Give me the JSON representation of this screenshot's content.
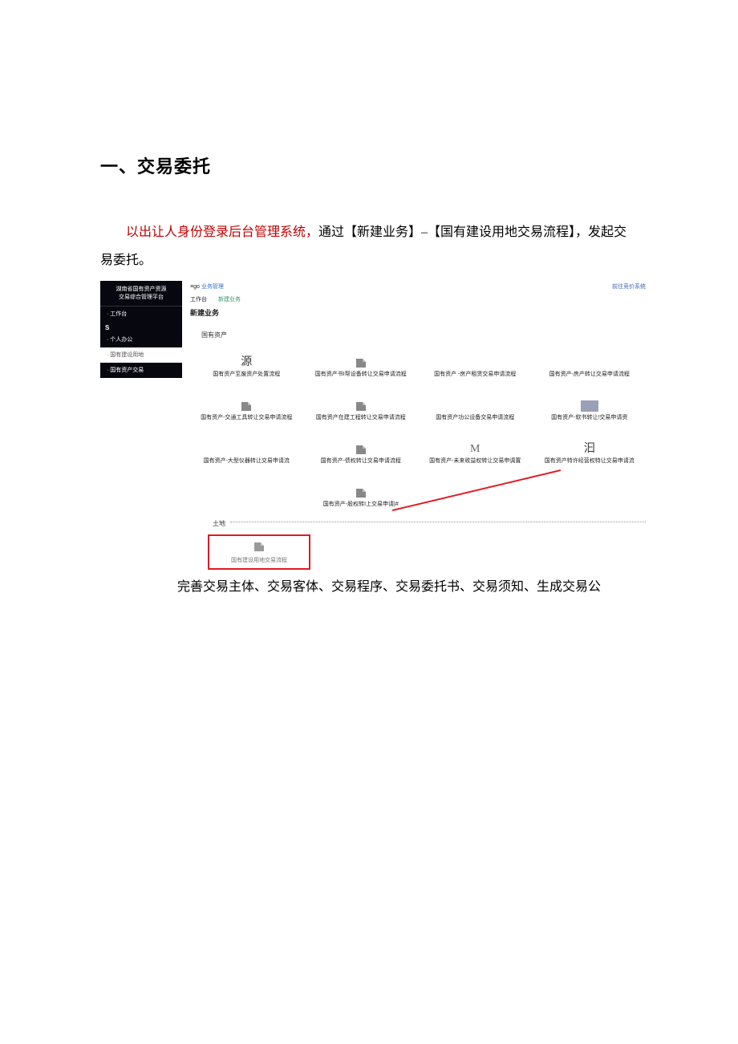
{
  "section_title": "一、交易委托",
  "para1_seg1_red": "以出让人身份登录后",
  "para1_seg2_red": "台管理系统，",
  "para1_seg3": "通过【新建业务】–【国有建设用地交易流程】，发起交易委托。",
  "after_para": "完善交易主体、交易客体、交易程序、交易委托书、交易须知、生成交易公",
  "screenshot": {
    "header_title_line1": "湖南省国有资产资源",
    "header_title_line2": "交易综合管理平台",
    "side_items": {
      "workbench": "工作台",
      "letterS": "S",
      "personal": "个人办公",
      "land": "国有建设用地",
      "asset_txn": "国有资产交易"
    },
    "top_left_prefix": "≡go ",
    "top_left_blue": "业务管理",
    "top_right": "前往竞价系统",
    "breadcrumb_a": "工作台",
    "breadcrumb_b": "新建业务",
    "page_title": "新建业务",
    "cat1": "国有资产",
    "tiles": {
      "r1c1_glyph": "源",
      "r1c1": "国有资产至废资产处置流程",
      "r1c2": "国有资产书I帮设备转让交易申请流程",
      "r1c3": "国有资产 -房产租赁交易申请流程",
      "r1c4": "国有资产-房产转让交易申请流程",
      "r2c1": "国有资产-交通工具转让交易申请流程",
      "r2c2": "国有资产在建工程转让交易申请流程",
      "r2c3": "国有资产功公设备交易申请流程",
      "r2c4": "国有资产-软书转让!交易申请资",
      "r3c1": "国有资产-大型仪器转让交易申请流",
      "r3c2": "国有资产-债权转让交易申请流程",
      "r3c3_glyph": "M",
      "r3c3": "国有资产-未来收益权转让交易申调置",
      "r3c4_glyph": "汩",
      "r3c4": "国有资产特许经营权特让交易申请流",
      "r4c2": "国有资产-股权转I上交易申请|#"
    },
    "cat2": "土地",
    "highlight_tile": "国有建设用地交易流程"
  }
}
